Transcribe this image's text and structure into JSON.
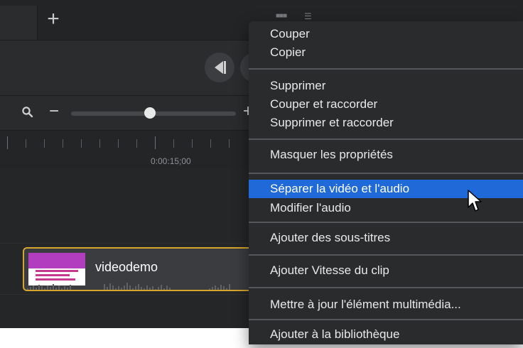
{
  "tabbar": {
    "add_symbol": "+"
  },
  "icons": {
    "add": "plus-icon",
    "layout_a": "grid-icon",
    "layout_b": "list-icon",
    "prev": "previous-frame-icon",
    "search": "magnifier-icon",
    "cursor": "mouse-pointer-icon"
  },
  "zoom": {
    "minus_symbol": "−",
    "plus_symbol": "+",
    "slider_value": 0.48
  },
  "ruler": {
    "timestamp": "0:00:15;00"
  },
  "clip": {
    "title": "videodemo"
  },
  "context_menu": {
    "items": [
      {
        "label": "Couper"
      },
      {
        "label": "Copier"
      },
      {
        "label": "Supprimer"
      },
      {
        "label": "Couper et raccorder"
      },
      {
        "label": "Supprimer et raccorder"
      },
      {
        "label": "Masquer les propriétés"
      },
      {
        "label": "Séparer la vidéo et l'audio",
        "active": true
      },
      {
        "label": "Modifier l'audio"
      },
      {
        "label": "Ajouter des sous-titres"
      },
      {
        "label": "Ajouter Vitesse du clip"
      },
      {
        "label": "Mettre à jour l'élément multimédia..."
      },
      {
        "label": "Ajouter à la bibliothèque"
      }
    ]
  },
  "colors": {
    "background": "#252627",
    "menu_bg": "#2a2b2d",
    "menu_active": "#1f6ad8",
    "clip_border": "#d7a52b",
    "text": "#e9e9ea"
  }
}
